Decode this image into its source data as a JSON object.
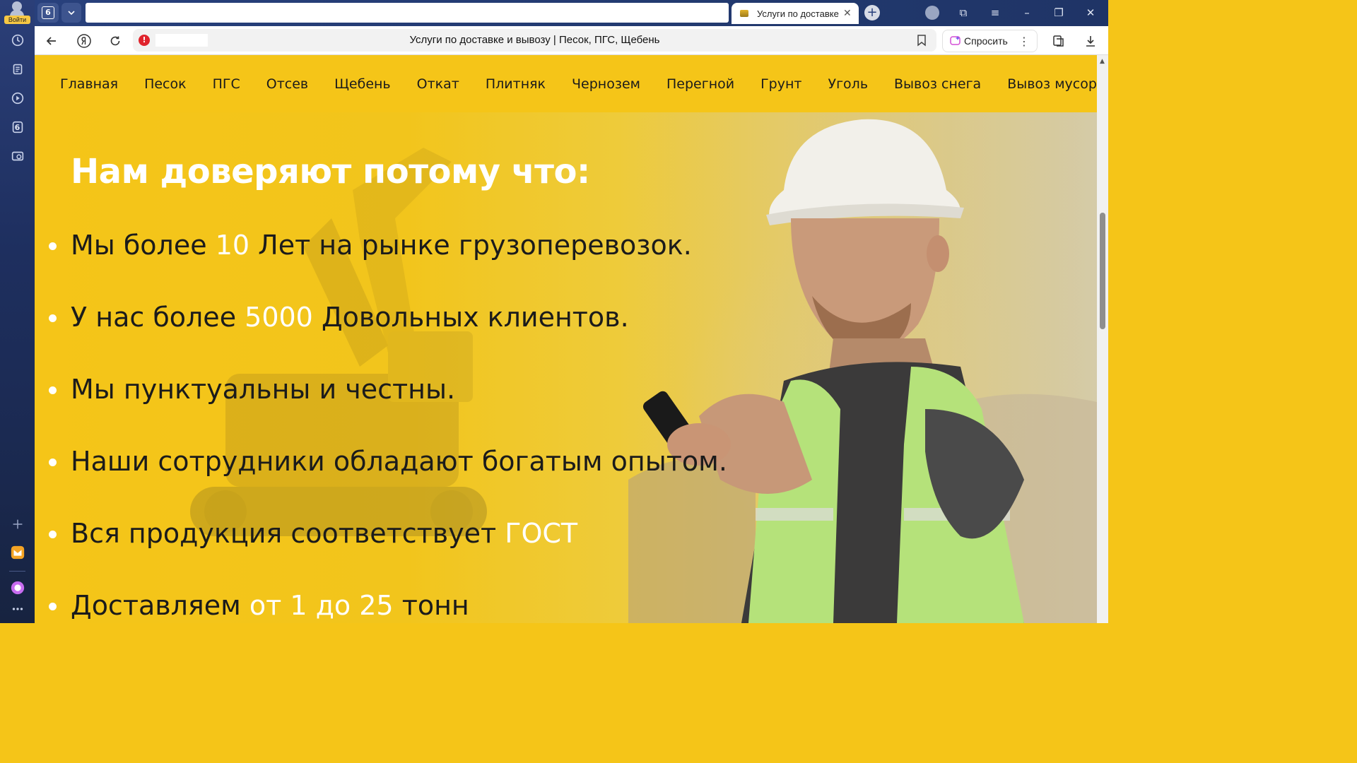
{
  "browser": {
    "login_label": "Войти",
    "tab_count": "6",
    "active_tab_title": "Услуги по доставке",
    "page_title": "Услуги по доставке и вывозу | Песок, ПГС, Щебень",
    "ask_label": "Спросить",
    "sidebar_tab_count": "6"
  },
  "nav": {
    "items": [
      "Главная",
      "Песок",
      "ПГС",
      "Отсев",
      "Щебень",
      "Откат",
      "Плитняк",
      "Чернозем",
      "Перегной",
      "Грунт",
      "Уголь",
      "Вывоз снега",
      "Вывоз мусора"
    ]
  },
  "hero": {
    "title": "Нам доверяют потому что:",
    "reasons": [
      {
        "before": "Мы более ",
        "highlight": "10",
        "after": " Лет на рынке грузоперевозок."
      },
      {
        "before": "У нас более ",
        "highlight": "5000",
        "after": " Довольных клиентов."
      },
      {
        "before": "Мы пунктуальны и честны.",
        "highlight": "",
        "after": ""
      },
      {
        "before": "Наши сотрудники обладают богатым опытом.",
        "highlight": "",
        "after": ""
      },
      {
        "before": "Вся продукция соответствует ",
        "highlight": "ГОСТ",
        "after": ""
      },
      {
        "before": "Доставляем ",
        "highlight": "от 1 до 25",
        "after": " тонн"
      }
    ]
  },
  "colors": {
    "brand_yellow": "#f5c518",
    "highlight_text": "#ffffff",
    "sidebar_bg": "#1e2f5f"
  }
}
